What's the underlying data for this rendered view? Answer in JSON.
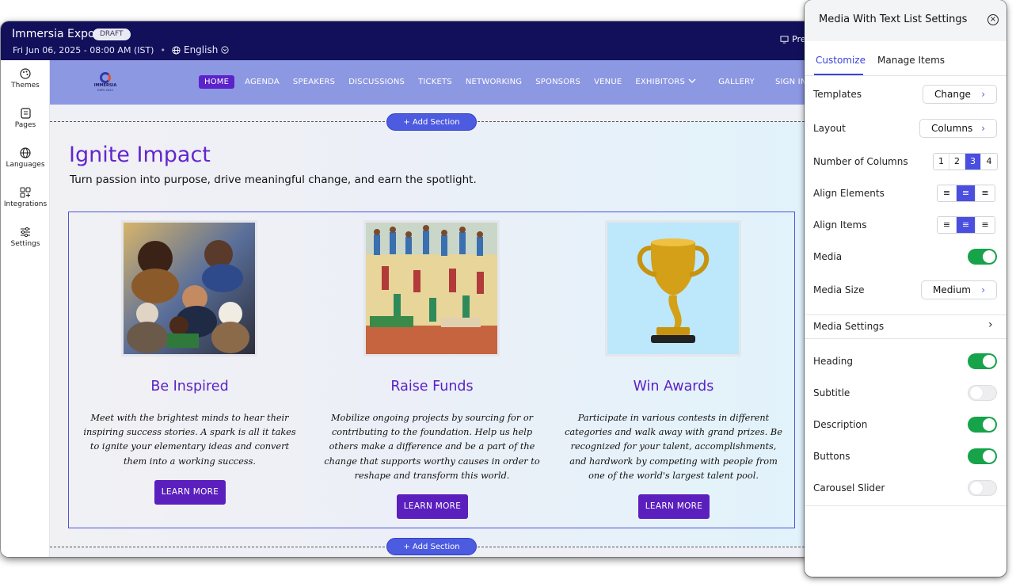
{
  "editor": {
    "app_title": "Immersia Expo",
    "status_badge": "DRAFT",
    "event_datetime": "Fri Jun 06, 2025 - 08:00 AM (IST)",
    "language": "English",
    "preview_label": "Pre"
  },
  "sidebar": {
    "items": [
      {
        "label": "Themes",
        "icon": "palette-icon"
      },
      {
        "label": "Pages",
        "icon": "pages-icon"
      },
      {
        "label": "Languages",
        "icon": "globe-icon"
      },
      {
        "label": "Integrations",
        "icon": "grid-plus-icon"
      },
      {
        "label": "Settings",
        "icon": "sliders-icon"
      }
    ]
  },
  "site": {
    "logo": {
      "name": "IMMERSIA",
      "sub": "EXPO 2025"
    },
    "nav": [
      "HOME",
      "AGENDA",
      "SPEAKERS",
      "DISCUSSIONS",
      "TICKETS",
      "NETWORKING",
      "SPONSORS",
      "VENUE",
      "EXHIBITORS",
      "GALLERY",
      "SIGN IN"
    ],
    "add_section_label": "+ Add Section",
    "section": {
      "heading": "Ignite Impact",
      "subtitle": "Turn passion into purpose, drive meaningful change, and earn the spotlight.",
      "cards": [
        {
          "heading": "Be Inspired",
          "description": "Meet with the brightest minds to hear their inspiring success stories. A spark is all it takes to ignite your elementary ideas and convert them into a working success.",
          "button": "LEARN MORE"
        },
        {
          "heading": "Raise Funds",
          "description": "Mobilize ongoing projects by sourcing for or contributing to the foundation. Help us help others make a difference and be a part of the change that supports worthy causes in order to reshape and transform this world.",
          "button": "LEARN MORE"
        },
        {
          "heading": "Win Awards",
          "description": "Participate in various contests in different categories and walk away with grand prizes. Be recognized for your talent, accomplishments, and hardwork by competing with people from one of the world's largest talent pool.",
          "button": "LEARN MORE"
        }
      ]
    }
  },
  "panel": {
    "title": "Media With Text List Settings",
    "tabs": [
      "Customize",
      "Manage Items"
    ],
    "active_tab": "Customize",
    "templates": {
      "label": "Templates",
      "value": "Change"
    },
    "layout": {
      "label": "Layout",
      "value": "Columns"
    },
    "columns": {
      "label": "Number of Columns",
      "options": [
        "1",
        "2",
        "3",
        "4"
      ],
      "selected": "3"
    },
    "align_elements": {
      "label": "Align Elements",
      "selected": "center"
    },
    "align_items": {
      "label": "Align Items",
      "selected": "center"
    },
    "media": {
      "label": "Media",
      "on": true
    },
    "media_size": {
      "label": "Media Size",
      "value": "Medium"
    },
    "media_settings": {
      "label": "Media Settings"
    },
    "heading": {
      "label": "Heading",
      "on": true
    },
    "subtitle": {
      "label": "Subtitle",
      "on": false
    },
    "description": {
      "label": "Description",
      "on": true
    },
    "buttons": {
      "label": "Buttons",
      "on": true
    },
    "carousel": {
      "label": "Carousel Slider",
      "on": false
    }
  },
  "colors": {
    "topbar": "#12105a",
    "nav": "#8d98e3",
    "accent": "#5b1fbe",
    "toggle_on": "#16a34a",
    "selected": "#4b4fe0"
  }
}
